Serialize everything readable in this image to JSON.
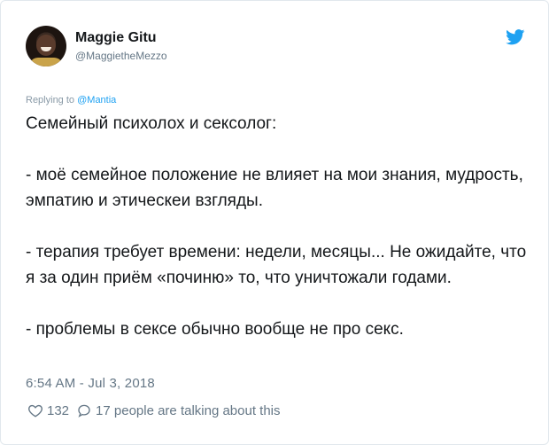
{
  "author": {
    "display_name": "Maggie Gitu",
    "handle": "@MaggietheMezzo",
    "avatar_icon": "profile-photo"
  },
  "reply": {
    "prefix": "Replying to",
    "mention": "@Mantia"
  },
  "tweet": {
    "paragraphs": [
      "Семейный психолох и сексолог:",
      "- моё семейное положение не влияет на мои знания, мудрость, эмпатию и этическеи взгляды.",
      "- терапия требует времени: недели, месяцы... Не ожидайте, что я за один приём «починю» то, что уничтожали годами.",
      "- проблемы в сексе обычно вообще не про секс."
    ],
    "timestamp": "6:54 AM - Jul 3, 2018"
  },
  "stats": {
    "likes": "132",
    "replies_text": "17 people are talking about this"
  },
  "colors": {
    "twitter_blue": "#1da1f2",
    "text": "#14171a",
    "muted": "#657786"
  }
}
